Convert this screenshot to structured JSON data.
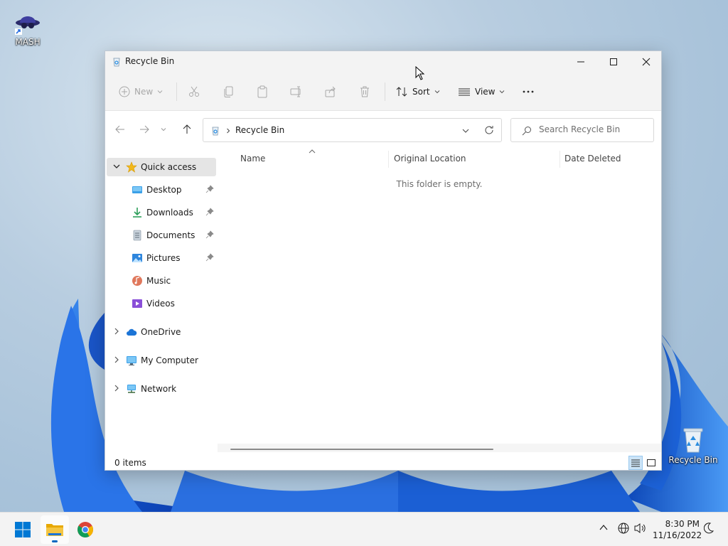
{
  "desktop": {
    "icons": [
      {
        "label": "MASH"
      },
      {
        "label": "Recycle Bin"
      }
    ]
  },
  "window": {
    "title": "Recycle Bin",
    "toolbar": {
      "new_label": "New",
      "sort_label": "Sort",
      "view_label": "View",
      "more_label": "···"
    },
    "address": {
      "breadcrumb": "Recycle Bin"
    },
    "search": {
      "placeholder": "Search Recycle Bin"
    },
    "nav": {
      "quick_access": "Quick access",
      "items": [
        {
          "label": "Desktop",
          "pinned": true,
          "icon": "desktop-icon"
        },
        {
          "label": "Downloads",
          "pinned": true,
          "icon": "downloads-icon"
        },
        {
          "label": "Documents",
          "pinned": true,
          "icon": "documents-icon"
        },
        {
          "label": "Pictures",
          "pinned": true,
          "icon": "pictures-icon"
        },
        {
          "label": "Music",
          "pinned": false,
          "icon": "music-icon"
        },
        {
          "label": "Videos",
          "pinned": false,
          "icon": "videos-icon"
        }
      ],
      "roots": [
        {
          "label": "OneDrive",
          "icon": "cloud-icon"
        },
        {
          "label": "My Computer",
          "icon": "computer-icon"
        },
        {
          "label": "Network",
          "icon": "network-icon"
        }
      ]
    },
    "columns": [
      "Name",
      "Original Location",
      "Date Deleted"
    ],
    "empty_message": "This folder is empty.",
    "status": {
      "item_count": "0 items"
    }
  },
  "taskbar": {
    "time": "8:30 PM",
    "date": "11/16/2022"
  },
  "colors": {
    "accent": "#0067c0",
    "folder": "#f4c542",
    "wallpaper_blue": "#1a5fd6"
  }
}
